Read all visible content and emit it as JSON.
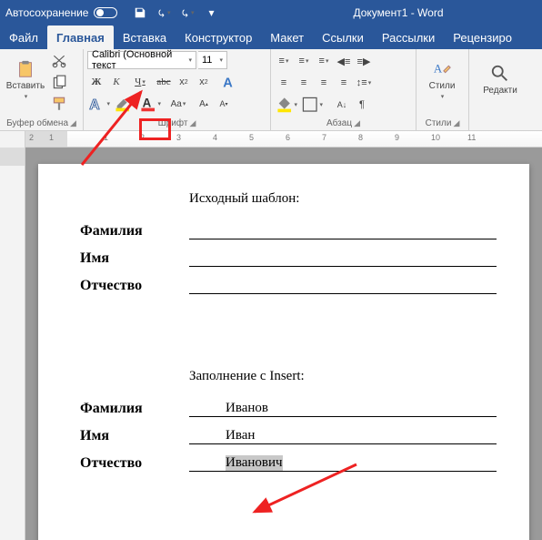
{
  "titlebar": {
    "autosave_label": "Автосохранение",
    "document_title": "Документ1 - Word"
  },
  "tabs": {
    "file": "Файл",
    "home": "Главная",
    "insert": "Вставка",
    "design": "Конструктор",
    "layout": "Макет",
    "references": "Ссылки",
    "mailings": "Рассылки",
    "review": "Рецензиро"
  },
  "ribbon": {
    "clipboard": {
      "paste_label": "Вставить",
      "group_label": "Буфер обмена"
    },
    "font": {
      "font_name": "Calibri (Основной текст",
      "font_size": "11",
      "bold": "Ж",
      "italic": "К",
      "underline": "Ч",
      "strike": "abc",
      "sub": "x",
      "sup": "x",
      "group_label": "Шрифт"
    },
    "paragraph": {
      "group_label": "Абзац"
    },
    "styles": {
      "label": "Стили",
      "group_label": "Стили"
    },
    "editing": {
      "label": "Редакти"
    }
  },
  "ruler": {
    "n2": "2",
    "n1": "1",
    "p1": "1",
    "p2": "2",
    "p3": "3",
    "p4": "4",
    "p5": "5",
    "p6": "6",
    "p7": "7",
    "p8": "8",
    "p9": "9",
    "p10": "10",
    "p11": "11"
  },
  "doc": {
    "heading1": "Исходный шаблон:",
    "heading2": "Заполнение с Insert:",
    "label_lastname": "Фамилия",
    "label_firstname": "Имя",
    "label_patronymic": "Отчество",
    "val_lastname": "Иванов",
    "val_firstname": "Иван",
    "val_patronymic": "Иванович"
  }
}
